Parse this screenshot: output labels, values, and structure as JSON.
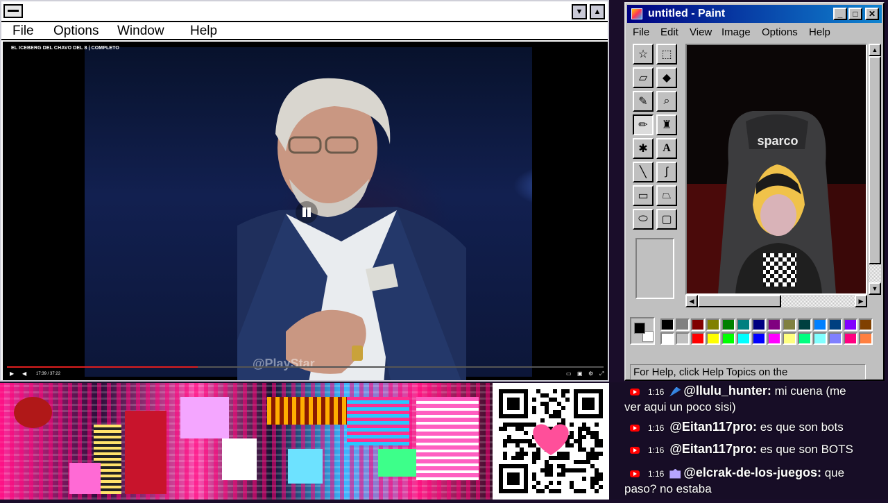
{
  "video_window": {
    "menu": [
      "File",
      "Options",
      "Window",
      "Help"
    ],
    "video_title": "EL ICEBERG DEL CHAVO DEL 8 | COMPLETO",
    "watermark": "@PlayStar",
    "time": "17:39 / 37:22",
    "progress": 0.32
  },
  "paint": {
    "title": "untitled - Paint",
    "menu": [
      "File",
      "Edit",
      "View",
      "Image",
      "Options",
      "Help"
    ],
    "status": "For Help, click Help Topics on the",
    "chair_logo": "sparco",
    "palette_top": [
      "#000000",
      "#808080",
      "#800000",
      "#808000",
      "#008000",
      "#008080",
      "#000080",
      "#800080",
      "#808040",
      "#004040",
      "#0080ff",
      "#004080",
      "#8000ff",
      "#804000"
    ],
    "palette_bottom": [
      "#ffffff",
      "#c0c0c0",
      "#ff0000",
      "#ffff00",
      "#00ff00",
      "#00ffff",
      "#0000ff",
      "#ff00ff",
      "#ffff80",
      "#00ff80",
      "#80ffff",
      "#8080ff",
      "#ff0080",
      "#ff8040"
    ]
  },
  "chat": [
    {
      "time": "1:16",
      "user": "@llulu_hunter:",
      "text": "mi cuena (me",
      "cont": "ver aqui un poco sisi)"
    },
    {
      "time": "1:16",
      "user": "@Eitan117pro:",
      "text": "es que son bots"
    },
    {
      "time": "1:16",
      "user": "@Eitan117pro:",
      "text": "es que son BOTS"
    },
    {
      "time": "1:16",
      "user": "@elcrak-de-los-juegos:",
      "text": "que",
      "cont": "paso? no estaba"
    }
  ]
}
